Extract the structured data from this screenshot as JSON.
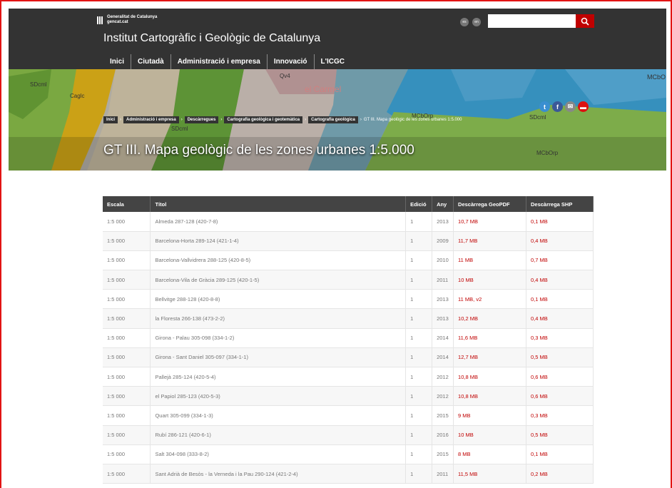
{
  "header": {
    "gencat_line1": "Generalitat de Catalunya",
    "gencat_line2": "gencat.cat",
    "site_title": "Institut Cartogràfic i Geològic de Catalunya",
    "lang_es": "es",
    "lang_en": "en",
    "search_placeholder": ""
  },
  "nav": [
    "Inici",
    "Ciutadà",
    "Administració i empresa",
    "Innovació",
    "L'ICGC"
  ],
  "breadcrumb": [
    "Inici",
    "Administració i empresa",
    "Descàrregues",
    "Cartografia geològica i geotemàtica",
    "Cartografia geològica"
  ],
  "breadcrumb_current": "GT III. Mapa geològic de les zones urbanes 1:5.000",
  "page_title": "GT III. Mapa geològic de les zones urbanes 1:5.000",
  "map_labels": [
    "SDcml",
    "Caglc",
    "Qv4",
    "el Carmel",
    "MCbOrp",
    "SDcml",
    "SDcml",
    "MCbOrp",
    "MCbO"
  ],
  "table": {
    "headers": [
      "Escala",
      "Títol",
      "Edició",
      "Any",
      "Descàrrega GeoPDF",
      "Descàrrega SHP"
    ],
    "rows": [
      [
        "1:5 000",
        "Almeda 287-128 (420-7-8)",
        "1",
        "2013",
        "10,7 MB",
        "0,1 MB"
      ],
      [
        "1:5 000",
        "Barcelona-Horta 289-124 (421-1-4)",
        "1",
        "2009",
        "11,7 MB",
        "0,4 MB"
      ],
      [
        "1:5 000",
        "Barcelona-Vallvidrera 288-125 (420-8-5)",
        "1",
        "2010",
        "11 MB",
        "0,7 MB"
      ],
      [
        "1:5 000",
        "Barcelona-Vila de Gràcia 289-125 (420-1-5)",
        "1",
        "2011",
        "10 MB",
        "0,4 MB"
      ],
      [
        "1:5 000",
        "Bellvitge 288-128 (420-8-8)",
        "1",
        "2013",
        "11 MB, v2",
        "0,1 MB"
      ],
      [
        "1:5 000",
        "la Floresta 266-138 (473-2-2)",
        "1",
        "2013",
        "10,2 MB",
        "0,4 MB"
      ],
      [
        "1:5 000",
        "Girona - Palau 305-098 (334-1-2)",
        "1",
        "2014",
        "11,6 MB",
        "0,3 MB"
      ],
      [
        "1:5 000",
        "Girona - Sant Daniel 305-097 (334-1-1)",
        "1",
        "2014",
        "12,7 MB",
        "0,5 MB"
      ],
      [
        "1:5 000",
        "Pallejà 285-124 (420-5-4)",
        "1",
        "2012",
        "10,8 MB",
        "0,6 MB"
      ],
      [
        "1:5 000",
        "el Papiol 285-123 (420-5-3)",
        "1",
        "2012",
        "10,8 MB",
        "0,6 MB"
      ],
      [
        "1:5 000",
        "Quart 305-099 (334-1-3)",
        "1",
        "2015",
        "9 MB",
        "0,3 MB"
      ],
      [
        "1:5 000",
        "Rubí 286-121 (420-6-1)",
        "1",
        "2016",
        "10 MB",
        "0,5 MB"
      ],
      [
        "1:5 000",
        "Salt 304-098 (333-8-2)",
        "1",
        "2015",
        "8 MB",
        "0,1 MB"
      ],
      [
        "1:5 000",
        "Sant Adrià de Besòs - la Verneda i la Pau 290-124 (421-2-4)",
        "1",
        "2011",
        "11,5 MB",
        "0,2 MB"
      ]
    ]
  }
}
